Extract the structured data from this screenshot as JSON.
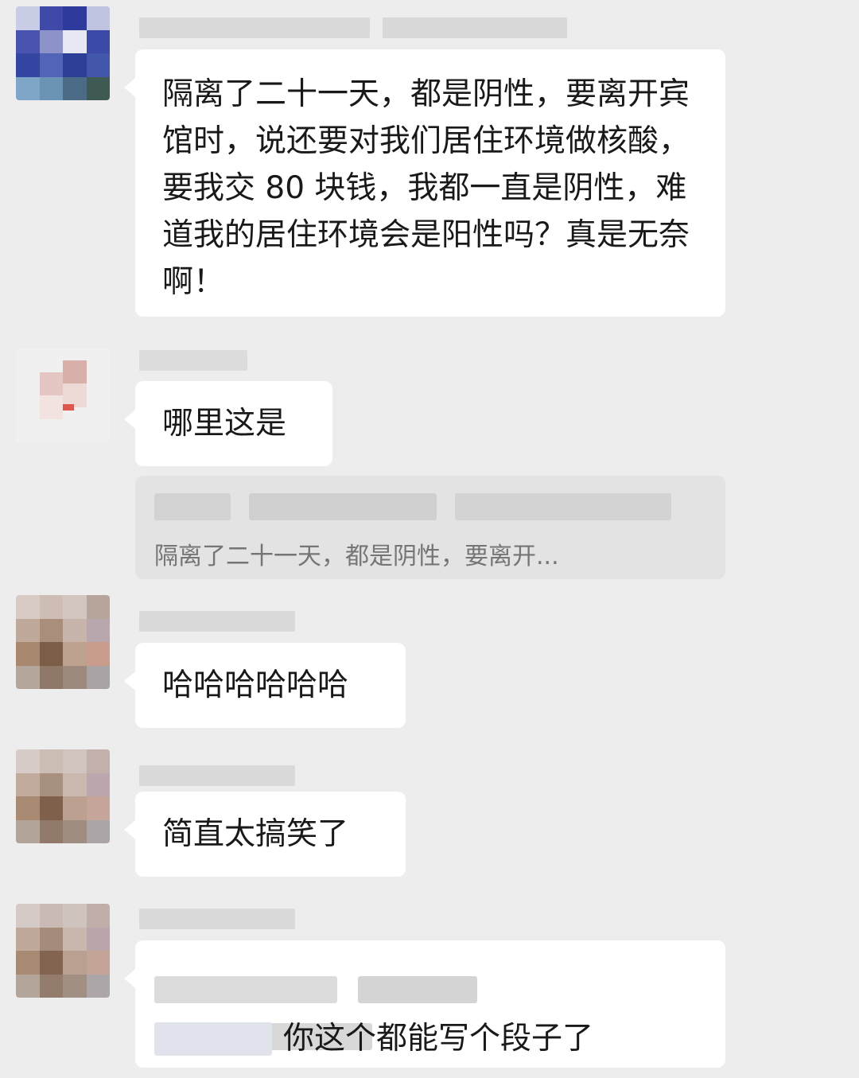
{
  "messages": [
    {
      "text": "隔离了二十一天，都是阴性，要离开宾馆时，说还要对我们居住环境做核酸，要我交 80 块钱，我都一直是阴性，难道我的居住环境会是阳性吗？真是无奈啊！"
    },
    {
      "text": "哪里这是"
    },
    {
      "quote_text": "隔离了二十一天，都是阴性，要离开..."
    },
    {
      "text": "哈哈哈哈哈哈"
    },
    {
      "text": "简直太搞笑了"
    },
    {
      "text": "你这个都能写个段子了"
    }
  ],
  "colors": {
    "background": "#ededed",
    "bubble": "#ffffff",
    "quote_bg": "#e3e3e3",
    "text": "#191919",
    "quote_text": "#757575"
  }
}
